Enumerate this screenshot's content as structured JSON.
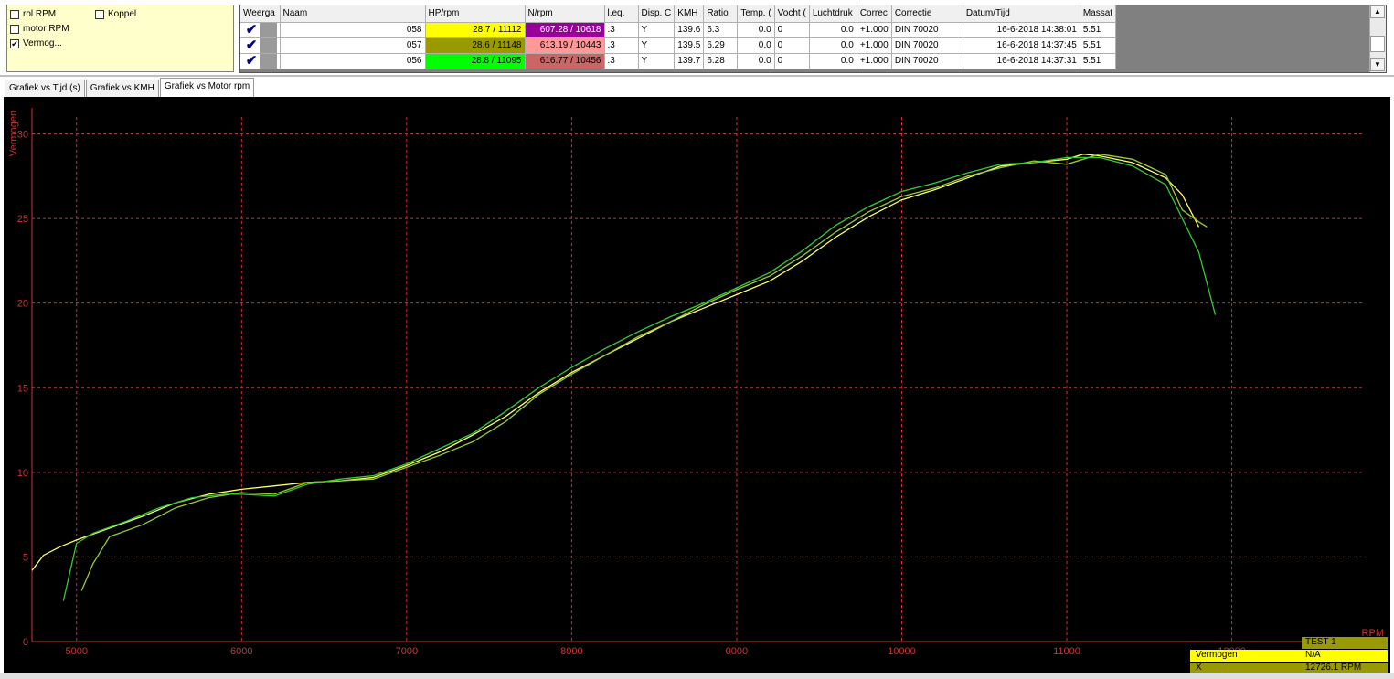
{
  "checkboxes": [
    {
      "label": "rol RPM",
      "checked": false
    },
    {
      "label": "Koppel",
      "checked": false
    },
    {
      "label": "motor RPM",
      "checked": false
    },
    {
      "label": "Vermog...",
      "checked": true
    }
  ],
  "table": {
    "headers": [
      "Weerga",
      "Naam",
      "HP/rpm",
      "N/rpm",
      "l.eq.",
      "Disp. C",
      "KMH",
      "Ratio",
      "Temp. (",
      "Vocht (",
      "Luchtdruk",
      "Correc",
      "Correctie",
      "Datum/Tijd",
      "Massat"
    ],
    "rows": [
      {
        "naam": "058",
        "hp": "28.7 / 11112",
        "hp_color": "#ffff00",
        "n": "607.28 / 10618",
        "n_color": "#990099",
        "n_text_color": "#ffffff",
        "leq": ".3",
        "disp": "Y",
        "kmh": "139.6",
        "ratio": "6.3",
        "temp": "0.0",
        "vocht": "0",
        "lucht": "0.0",
        "correc": "+1.000",
        "correctie": "DIN 70020",
        "datum": "16-6-2018 14:38:01",
        "massa": "5.51"
      },
      {
        "naam": "057",
        "hp": "28.6 / 11148",
        "hp_color": "#999900",
        "n": "613.19 / 10443",
        "n_color": "#ff9999",
        "n_text_color": "#000000",
        "leq": ".3",
        "disp": "Y",
        "kmh": "139.5",
        "ratio": "6.29",
        "temp": "0.0",
        "vocht": "0",
        "lucht": "0.0",
        "correc": "+1.000",
        "correctie": "DIN 70020",
        "datum": "16-6-2018 14:37:45",
        "massa": "5.51"
      },
      {
        "naam": "056",
        "hp": "28.8 / 11095",
        "hp_color": "#00ff00",
        "n": "616.77 / 10456",
        "n_color": "#cc6666",
        "n_text_color": "#000000",
        "leq": ".3",
        "disp": "Y",
        "kmh": "139.7",
        "ratio": "6.28",
        "temp": "0.0",
        "vocht": "0",
        "lucht": "0.0",
        "correc": "+1.000",
        "correctie": "DIN 70020",
        "datum": "16-6-2018 14:37:31",
        "massa": "5.51"
      }
    ]
  },
  "tabs": [
    {
      "label": "Grafiek vs Tijd (s)",
      "active": false
    },
    {
      "label": "Grafiek vs KMH",
      "active": false
    },
    {
      "label": "Grafiek vs Motor rpm",
      "active": true
    }
  ],
  "readout": {
    "test_label": "TEST 1",
    "series_label": "Vermogen",
    "series_value": "N/A",
    "x_label": "X",
    "x_value": "12726.1 RPM"
  },
  "colors": {
    "grid": "#cc3333",
    "axis": "#cc3333",
    "background": "#000000"
  },
  "chart_data": {
    "type": "line",
    "ylabel": "Vermogen",
    "xlabel": "RPM",
    "xlim": [
      4730,
      12800
    ],
    "ylim": [
      0,
      31
    ],
    "xticks": [
      "5000",
      "6000",
      "7000",
      "8000",
      "0000",
      "10000",
      "11000",
      "12000"
    ],
    "xtick_values": [
      5000,
      6000,
      7000,
      8000,
      9000,
      10000,
      11000,
      12000
    ],
    "yticks": [
      0,
      5,
      10,
      15,
      20,
      25,
      30
    ],
    "grid": true,
    "series": [
      {
        "color": "#ffff66",
        "x": [
          4730,
          4800,
          4900,
          5000,
          5200,
          5400,
          5600,
          5800,
          6000,
          6200,
          6400,
          6600,
          6800,
          7000,
          7200,
          7400,
          7600,
          7800,
          8000,
          8200,
          8400,
          8600,
          8800,
          9000,
          9200,
          9400,
          9600,
          9800,
          10000,
          10200,
          10400,
          10600,
          10800,
          11000,
          11100,
          11200,
          11400,
          11600,
          11700,
          11800
        ],
        "y": [
          4.2,
          5.1,
          5.6,
          6.0,
          6.7,
          7.4,
          8.2,
          8.7,
          9.0,
          9.2,
          9.4,
          9.5,
          9.7,
          10.4,
          11.2,
          12.2,
          13.3,
          14.7,
          15.9,
          16.9,
          17.9,
          18.9,
          19.7,
          20.5,
          21.3,
          22.5,
          23.9,
          25.1,
          26.1,
          26.7,
          27.4,
          28.1,
          28.3,
          28.5,
          28.8,
          28.7,
          28.3,
          27.4,
          26.4,
          24.5
        ]
      },
      {
        "color": "#99cc33",
        "x": [
          5030,
          5100,
          5200,
          5400,
          5600,
          5800,
          6000,
          6200,
          6400,
          6600,
          6800,
          7000,
          7200,
          7400,
          7600,
          7800,
          8000,
          8200,
          8400,
          8600,
          8800,
          9000,
          9200,
          9400,
          9600,
          9800,
          10000,
          10200,
          10400,
          10600,
          10800,
          11000,
          11200,
          11400,
          11600,
          11700,
          11800,
          11850
        ],
        "y": [
          3.0,
          4.6,
          6.2,
          6.9,
          7.9,
          8.5,
          8.8,
          8.7,
          9.4,
          9.5,
          9.6,
          10.3,
          11.0,
          11.8,
          13.0,
          14.6,
          15.8,
          16.9,
          18.0,
          18.9,
          19.9,
          20.8,
          21.6,
          22.8,
          24.2,
          25.4,
          26.3,
          26.8,
          27.5,
          28.0,
          28.4,
          28.2,
          28.8,
          28.5,
          27.6,
          25.5,
          24.8,
          24.5
        ]
      },
      {
        "color": "#33cc33",
        "x": [
          4920,
          5000,
          5100,
          5300,
          5500,
          5700,
          5900,
          6000,
          6200,
          6400,
          6600,
          6800,
          7000,
          7200,
          7400,
          7600,
          7800,
          8000,
          8200,
          8400,
          8600,
          8800,
          9000,
          9200,
          9400,
          9600,
          9800,
          10000,
          10200,
          10400,
          10600,
          10800,
          11000,
          11200,
          11400,
          11600,
          11700,
          11800,
          11900
        ],
        "y": [
          2.4,
          5.8,
          6.4,
          7.1,
          7.9,
          8.5,
          8.7,
          8.7,
          8.6,
          9.3,
          9.6,
          9.8,
          10.5,
          11.4,
          12.3,
          13.6,
          15.0,
          16.2,
          17.3,
          18.3,
          19.2,
          20.0,
          20.9,
          21.8,
          23.1,
          24.6,
          25.7,
          26.6,
          27.1,
          27.7,
          28.2,
          28.3,
          28.6,
          28.6,
          28.1,
          27.0,
          25.0,
          23.0,
          19.3
        ]
      }
    ]
  }
}
